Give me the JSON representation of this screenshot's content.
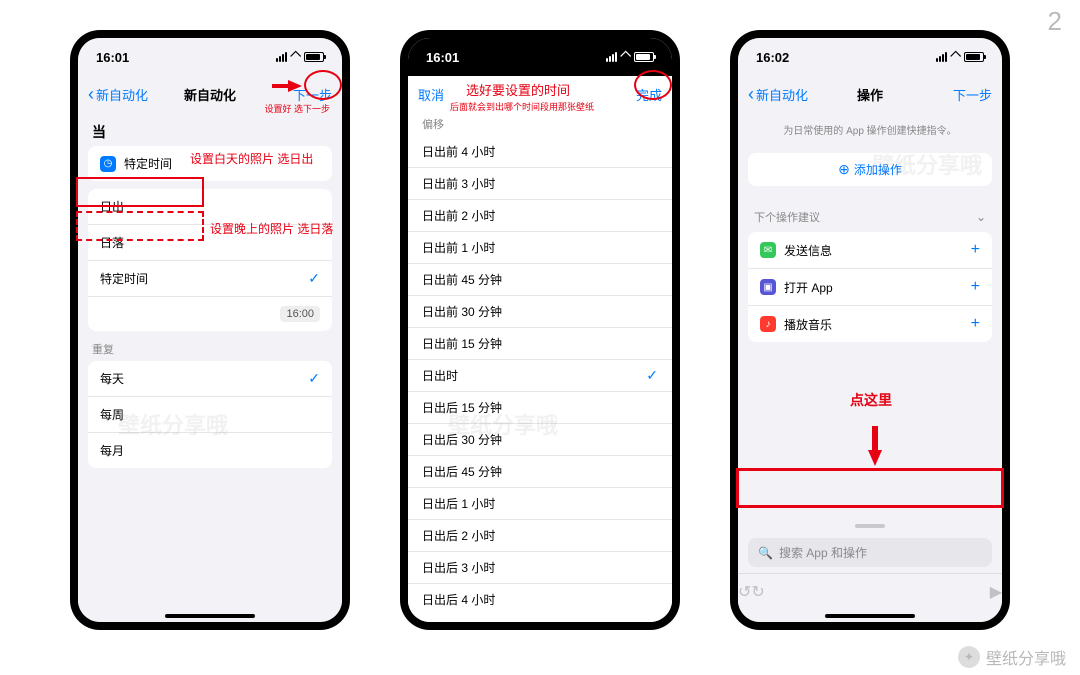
{
  "page_number": "2",
  "status_time_a": "16:01",
  "status_time_b": "16:01",
  "status_time_c": "16:02",
  "phone1": {
    "back": "新自动化",
    "title": "新自动化",
    "next": "下一步",
    "section_when": "当",
    "cell_specific_time": "特定时间",
    "opt_sunrise": "日出",
    "opt_sunset": "日落",
    "opt_specific": "特定时间",
    "time_value": "16:00",
    "section_repeat": "重复",
    "repeat_daily": "每天",
    "repeat_weekly": "每周",
    "repeat_monthly": "每月"
  },
  "annot1": {
    "hint_next": "设置好 选下一步",
    "day_hint": "设置白天的照片 选日出",
    "night_hint": "设置晚上的照片 选日落"
  },
  "phone2": {
    "cancel": "取消",
    "done": "完成",
    "section_offset": "偏移",
    "options": [
      "日出前 4 小时",
      "日出前 3 小时",
      "日出前 2 小时",
      "日出前 1 小时",
      "日出前 45 分钟",
      "日出前 30 分钟",
      "日出前 15 分钟",
      "日出时",
      "日出后 15 分钟",
      "日出后 30 分钟",
      "日出后 45 分钟",
      "日出后 1 小时",
      "日出后 2 小时",
      "日出后 3 小时",
      "日出后 4 小时"
    ],
    "selected_index": 7
  },
  "annot2": {
    "title_hint": "选好要设置的时间",
    "sub_hint": "后面就会到出哪个时间段用那张壁纸"
  },
  "phone3": {
    "back": "新自动化",
    "title": "操作",
    "next": "下一步",
    "hint": "为日常使用的 App 操作创建快捷指令。",
    "add_action": "添加操作",
    "suggest_header": "下个操作建议",
    "s1": "发送信息",
    "s2": "打开 App",
    "s3": "播放音乐",
    "search_placeholder": "搜索 App 和操作"
  },
  "annot3": {
    "click_here": "点这里"
  },
  "watermark": "壁纸分享哦",
  "phantom_watermark": "壁纸分享哦"
}
